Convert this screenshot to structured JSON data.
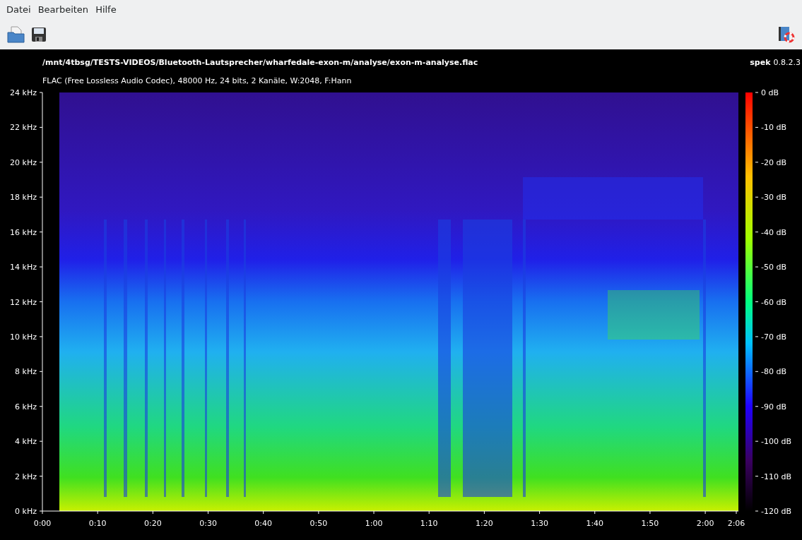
{
  "menu": [
    "Datei",
    "Bearbeiten",
    "Hilfe"
  ],
  "header": {
    "file_path": "/mnt/4tbsg/TESTS-VIDEOS/Bluetooth-Lautsprecher/wharfedale-exon-m/analyse/exon-m-analyse.flac",
    "stream_info": "FLAC (Free Lossless Audio Codec), 48000 Hz, 24 bits, 2 Kanäle, W:2048, F:Hann",
    "app_name": "spek",
    "app_version": "0.8.2.3"
  },
  "frequency_axis": [
    "24 kHz",
    "22 kHz",
    "20 kHz",
    "18 kHz",
    "16 kHz",
    "14 kHz",
    "12 kHz",
    "10 kHz",
    "8 kHz",
    "6 kHz",
    "4 kHz",
    "2 kHz",
    "0 kHz"
  ],
  "time_axis": [
    "0:00",
    "0:10",
    "0:20",
    "0:30",
    "0:40",
    "0:50",
    "1:00",
    "1:10",
    "1:20",
    "1:30",
    "1:40",
    "1:50",
    "2:00",
    "2:06"
  ],
  "level_scale": [
    "0 dB",
    "-10 dB",
    "-20 dB",
    "-30 dB",
    "-40 dB",
    "-50 dB",
    "-60 dB",
    "-70 dB",
    "-80 dB",
    "-90 dB",
    "-100 dB",
    "-110 dB",
    "-120 dB"
  ]
}
